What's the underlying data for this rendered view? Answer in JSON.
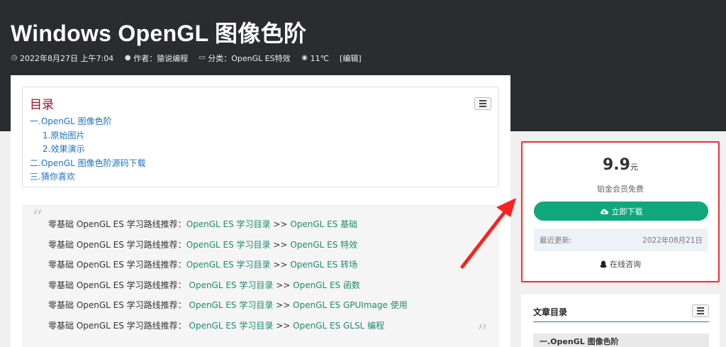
{
  "header": {
    "title": "Windows OpenGL 图像色阶",
    "meta": {
      "date": "2022年8月27日 上午7:04",
      "author": "作者：猿说编程",
      "category": "分类：OpenGL ES特效",
      "views": "11℃",
      "edit": "[编辑]"
    }
  },
  "toc": {
    "title": "目录",
    "items": [
      {
        "label": "一.OpenGL 图像色阶"
      },
      {
        "label": "1.原始图片"
      },
      {
        "label": "2.效果演示"
      },
      {
        "label": "二.OpenGL 图像色阶源码下载"
      },
      {
        "label": "三.猜你喜欢"
      }
    ]
  },
  "quote": {
    "lines": [
      {
        "prefix": "零基础 OpenGL ES 学习路线推荐：",
        "link1": "OpenGL ES 学习目录",
        "sep": " >> ",
        "link2": "OpenGL ES 基础"
      },
      {
        "prefix": "零基础 OpenGL ES 学习路线推荐：",
        "link1": "OpenGL ES 学习目录",
        "sep": "  >> ",
        "link2": "OpenGL ES 特效"
      },
      {
        "prefix": "零基础 OpenGL ES 学习路线推荐：",
        "link1": "OpenGL ES 学习目录",
        "sep": "  >> ",
        "link2": "OpenGL ES 转场"
      },
      {
        "prefix": "零基础 OpenGL ES 学习路线推荐：  ",
        "link1": "OpenGL ES 学习目录",
        "sep": " >> ",
        "link2": "OpenGL ES 函数"
      },
      {
        "prefix": "零基础 OpenGL ES 学习路线推荐：  ",
        "link1": "OpenGL ES 学习目录",
        "sep": " >> ",
        "link2": "OpenGL ES GPUImage 使用"
      },
      {
        "prefix": "零基础 OpenGL ES 学习路线推荐：  ",
        "link1": "OpenGL ES 学习目录",
        "sep": " >> ",
        "link2": "OpenGL ES GLSL 编程"
      }
    ]
  },
  "purchase": {
    "price": "9.9",
    "unit": "元",
    "note": "铂金会员免费",
    "download_label": "立即下载",
    "updated_label": "最近更新:",
    "updated_date": "2022年08月21日",
    "consult_label": "在线咨询"
  },
  "side_toc": {
    "title": "文章目录",
    "first_item": "一.OpenGL 图像色阶"
  },
  "colors": {
    "hero_bg": "#2b2c2f",
    "accent_green": "#10a77c",
    "link_blue": "#1a73c8",
    "toc_title_red": "#a0102a",
    "highlight_red": "#ff2a2a"
  },
  "icons": [
    "clock-icon",
    "user-icon",
    "folder-icon",
    "eye-icon",
    "toc-toggle-icon",
    "cloud-download-icon",
    "qq-icon",
    "quote-open-icon",
    "quote-close-icon"
  ]
}
